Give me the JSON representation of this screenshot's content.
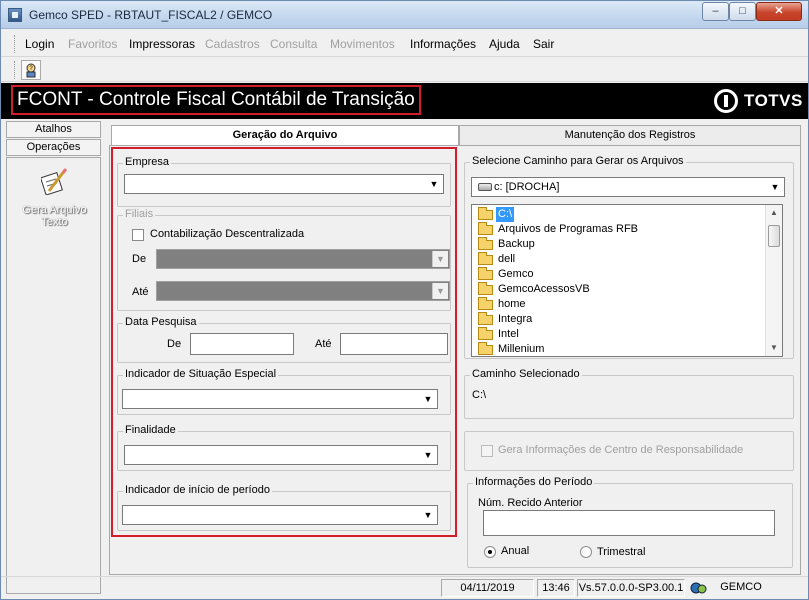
{
  "window": {
    "title": "Gemco SPED - RBTAUT_FISCAL2 / GEMCO",
    "min_glyph": "–",
    "max_glyph": "□",
    "close_glyph": "✕"
  },
  "menu": [
    {
      "label": "Login",
      "enabled": true
    },
    {
      "label": "Favoritos",
      "enabled": false
    },
    {
      "label": "Impressoras",
      "enabled": true
    },
    {
      "label": "Cadastros",
      "enabled": false
    },
    {
      "label": "Consulta",
      "enabled": false
    },
    {
      "label": "Movimentos",
      "enabled": false
    },
    {
      "label": "Informações",
      "enabled": true
    },
    {
      "label": "Ajuda",
      "enabled": true
    },
    {
      "label": "Sair",
      "enabled": true
    }
  ],
  "banner": {
    "title": "FCONT - Controle Fiscal Contábil de Transição",
    "brand": "TOTVS"
  },
  "sidebar": {
    "tabs": [
      "Atalhos",
      "Operações"
    ],
    "shortcut_label_line1": "Gera Arquivo",
    "shortcut_label_line2": "Texto"
  },
  "tabs": {
    "active": "Geração do Arquivo",
    "inactive": "Manutenção dos Registros"
  },
  "form": {
    "empresa_label": "Empresa",
    "empresa_value": "",
    "filiais_label": "Filiais",
    "contab_descentralizada_label": "Contabilização Descentralizada",
    "contab_descentralizada_checked": false,
    "de_label": "De",
    "ate_label": "Até",
    "data_pesquisa_label": "Data Pesquisa",
    "data_de_label": "De",
    "data_ate_label": "Até",
    "data_de_value": "",
    "data_ate_value": "",
    "indicador_situacao_label": "Indicador de Situação Especial",
    "finalidade_label": "Finalidade",
    "indicador_inicio_label": "Indicador de início de período"
  },
  "right": {
    "caminho_group_label": "Selecione Caminho  para Gerar os Arquivos",
    "drive_value": "c: [DROCHA]",
    "folders": [
      "C:\\",
      "Arquivos de Programas RFB",
      "Backup",
      "dell",
      "Gemco",
      "GemcoAcessosVB",
      "home",
      "Integra",
      "Intel",
      "Millenium"
    ],
    "selected_folder": "C:\\",
    "caminho_selecionado_label": "Caminho Selecionado",
    "caminho_selecionado_value": "C:\\",
    "centro_resp_label": "Gera Informações de Centro de Responsabilidade",
    "info_periodo_label": "Informações do  Período",
    "num_recibo_label": "Núm. Recido Anterior",
    "num_recibo_value": "",
    "anual_label": "Anual",
    "trimestral_label": "Trimestral",
    "selected_periodicity": "Anual"
  },
  "status": {
    "date": "04/11/2019",
    "time": "13:46",
    "version": "Vs.57.0.0.0-SP3.00.1",
    "company": "GEMCO"
  },
  "icons": {
    "toolbar_icon": "help-user-icon",
    "sidebar_icon": "gera-arquivo-pencil-icon",
    "status_icon": "network-icon"
  },
  "colors": {
    "banner_bg": "#000000",
    "highlight_border": "#d21e2a",
    "selection": "#3399ff"
  }
}
